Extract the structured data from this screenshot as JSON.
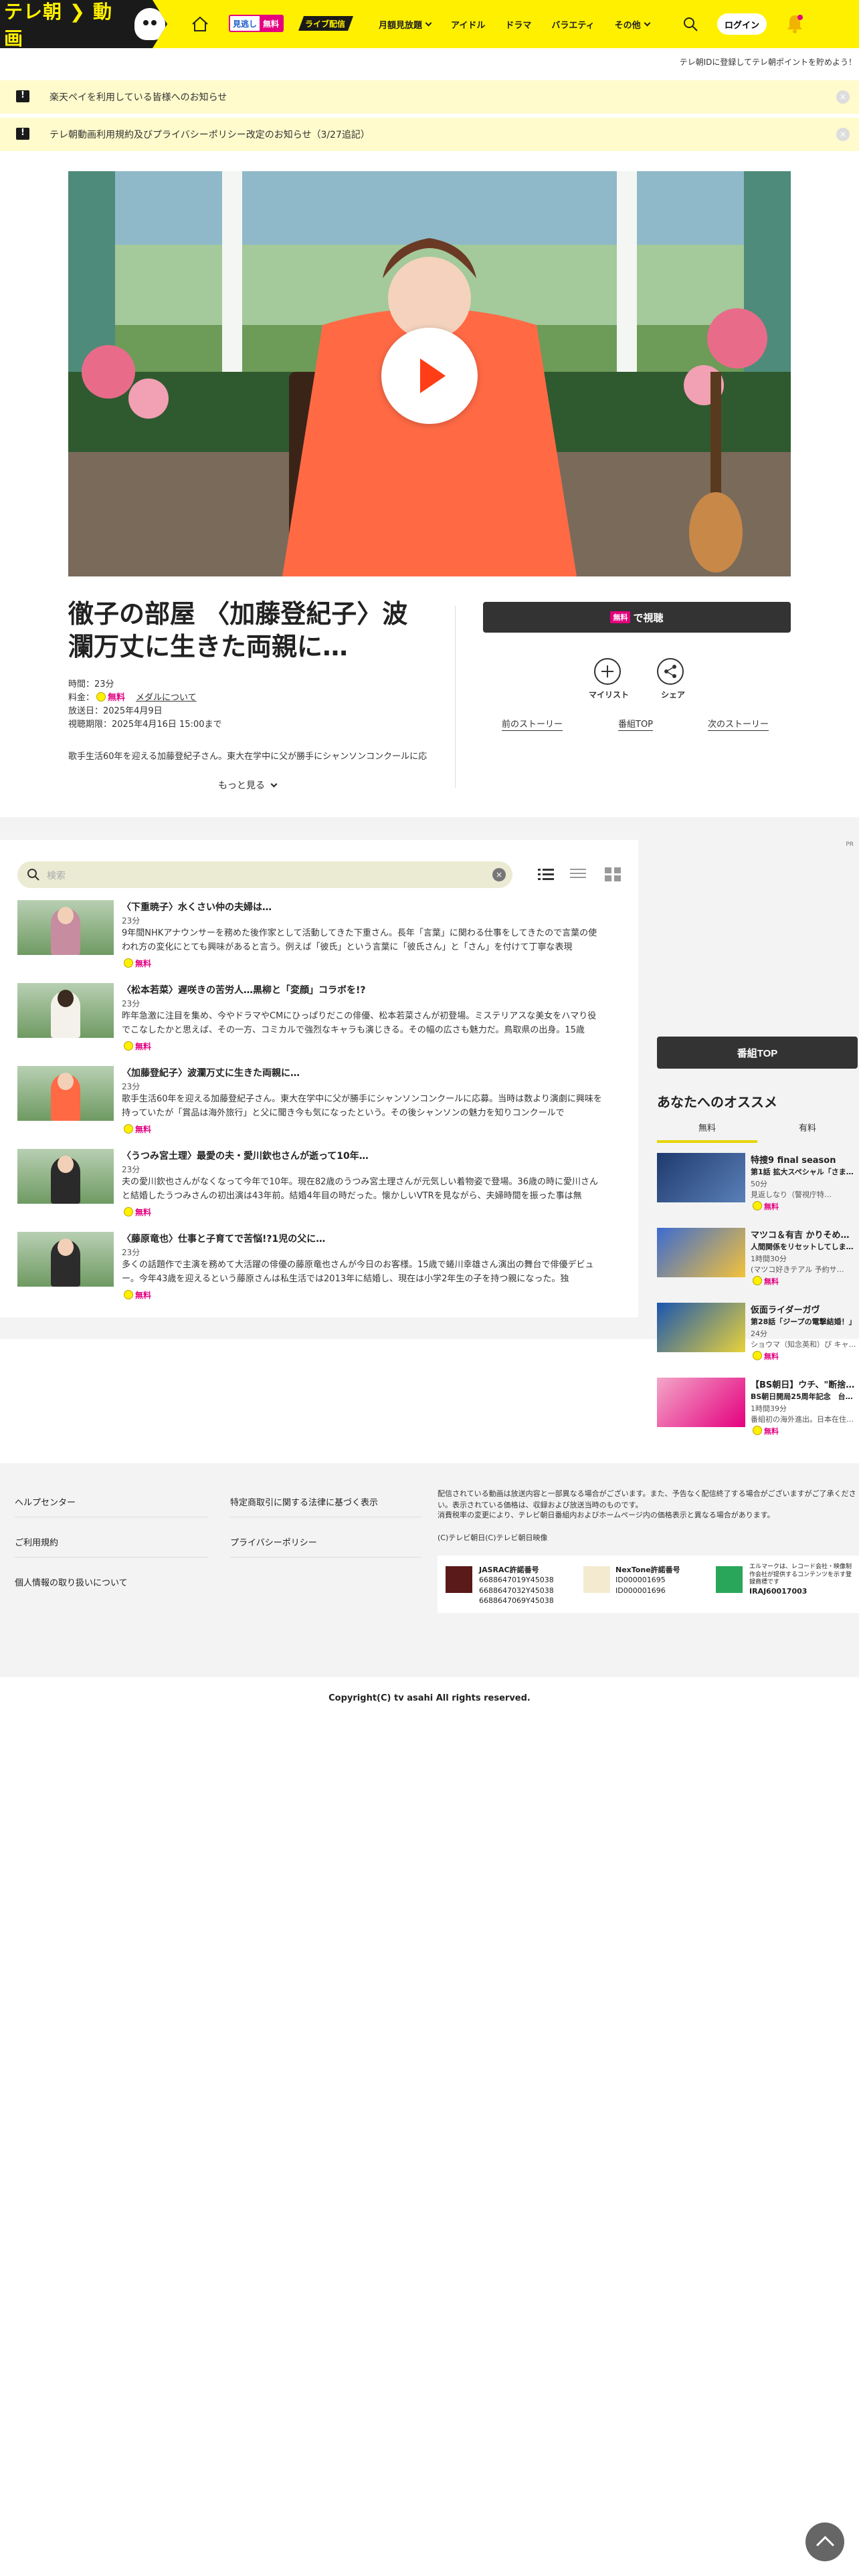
{
  "header": {
    "logo_text": "テレ朝",
    "logo_arrow": "動画",
    "badge_free_left": "見逃し",
    "badge_free_right": "無料",
    "badge_live": "ライブ配信",
    "nav": [
      "月額見放題",
      "アイドル",
      "ドラマ",
      "バラエティ",
      "その他"
    ],
    "login": "ログイン",
    "brand_color": "#fff000"
  },
  "top_note": "テレ朝IDに登録してテレ朝ポイントを貯めよう！",
  "notices": [
    "楽天ペイを利用している皆様へのお知らせ",
    "テレ朝動画利用規約及びプライバシーポリシー改定のお知らせ（3/27追記）"
  ],
  "episode": {
    "title": "徹子の部屋 〈加藤登紀子〉波瀾万丈に生きた両親に…",
    "duration": "時間：23分",
    "price_label": "料金：",
    "free": "無料",
    "medal_link": "メダルについて",
    "broadcast": "放送日：2025年4月9日",
    "deadline": "視聴期限：2025年4月16日 15:00まで",
    "description": "歌手生活60年を迎える加藤登紀子さん。東大在学中に父が勝手にシャンソンコンクールに応",
    "more": "もっと見る"
  },
  "actions": {
    "watch_tag": "無料",
    "watch_label": "で視聴",
    "mylist": "マイリスト",
    "share": "シェア",
    "prev": "前のストーリー",
    "program_top": "番組TOP",
    "next": "次のストーリー"
  },
  "list": {
    "search_placeholder": "検索",
    "free_label": "無料",
    "episodes": [
      {
        "title": "〈下重暁子〉水くさい仲の夫婦は…",
        "duration": "23分",
        "desc": "9年間NHKアナウンサーを務めた後作家として活動してきた下重さん。長年「言葉」に関わる仕事をしてきたので言葉の使われ方の変化にとても興味があると言う。例えば「彼氏」という言葉に「彼氏さん」と「さん」を付けて丁寧な表現"
      },
      {
        "title": "〈松本若菜〉遅咲きの苦労人…黒柳と「変顔」コラボを!?",
        "duration": "23分",
        "desc": "昨年急激に注目を集め、今やドラマやCMにひっぱりだこの俳優、松本若菜さんが初登場。ミステリアスな美女をハマり役でこなしたかと思えば、その一方、コミカルで強烈なキャラも演じきる。その幅の広さも魅力だ。鳥取県の出身。15歳"
      },
      {
        "title": "〈加藤登紀子〉波瀾万丈に生きた両親に…",
        "duration": "23分",
        "desc": "歌手生活60年を迎える加藤登紀子さん。東大在学中に父が勝手にシャンソンコンクールに応募。当時は数より演劇に興味を持っていたが「賞品は海外旅行」と父に聞き今も気になったという。その後シャンソンの魅力を知りコンクールで"
      },
      {
        "title": "〈うつみ宮土理〉最愛の夫・愛川欽也さんが逝って10年…",
        "duration": "23分",
        "desc": "夫の愛川欽也さんがなくなって今年で10年。現在82歳のうつみ宮土理さんが元気しい着物姿で登場。36歳の時に愛川さんと結婚したうつみさんの初出演は43年前。結婚4年目の時だった。懐かしいVTRを見ながら、夫婦時間を振った事は無"
      },
      {
        "title": "〈藤原竜也〉仕事と子育てで苦悩!?1児の父に…",
        "duration": "23分",
        "desc": "多くの話題作で主演を務めて大活躍の俳優の藤原竜也さんが今日のお客様。15歳で蜷川幸雄さん演出の舞台で俳優デビュー。今年43歳を迎えるという藤原さんは私生活では2013年に結婚し、現在は小学2年生の子を持つ親になった。独"
      }
    ]
  },
  "sidebar": {
    "program_top": "番組TOP",
    "rec_title": "あなたへのオススメ",
    "tabs": [
      "無料",
      "有料"
    ],
    "free_label": "無料",
    "items": [
      {
        "name": "特捜9 final season",
        "sub": "第1話 拡大スペシャル「さま…",
        "dur": "50分",
        "note": "見返しなり（警視庁特…"
      },
      {
        "name": "マツコ＆有吉 かりそめ…",
        "sub": "人間関係をリセットしてしま…",
        "dur": "1時間30分",
        "note": "(マツコ好きテアル 予約サ…"
      },
      {
        "name": "仮面ライダーガヴ",
        "sub": "第28話「ジープの電撃結婚！」",
        "dur": "24分",
        "note": "ショウマ（知念英和）ぴ キャ…"
      },
      {
        "name": "【BS朝日】ウチ、\"断捨…",
        "sub": "BS朝日開局25周年記念　台…",
        "dur": "1時間39分",
        "note": "番組初の海外進出。日本在住…"
      }
    ]
  },
  "footer": {
    "links_left": [
      "ヘルプセンター",
      "ご利用規約",
      "個人情報の取り扱いについて"
    ],
    "links_right": [
      "特定商取引に関する法律に基づく表示",
      "プライバシーポリシー"
    ],
    "note1": "配信されている動画は放送内容と一部異なる場合がございます。また、予告なく配信終了する場合がございますがご了承ください。表示されている価格は、収録および放送当時のものです。",
    "note2": "消費税率の変更により、テレビ朝日番組内およびホームページ内の価格表示と異なる場合があります。",
    "note3": "(C)テレビ朝日(C)テレビ朝日映像",
    "jasrac_title": "JASRAC許諾番号",
    "jasrac_nums": [
      "6688647019Y45038",
      "6688647032Y45038",
      "6688647069Y45038"
    ],
    "nextone_title": "NexTone許諾番号",
    "nextone_nums": [
      "ID000001695",
      "ID000001696"
    ],
    "erm_text": "エルマークは、レコード会社・映像制作会社が提供するコンテンツを示す登録商標です",
    "erm_num": "IRAJ60017003",
    "copyright": "Copyright(C) tv asahi All rights reserved."
  }
}
